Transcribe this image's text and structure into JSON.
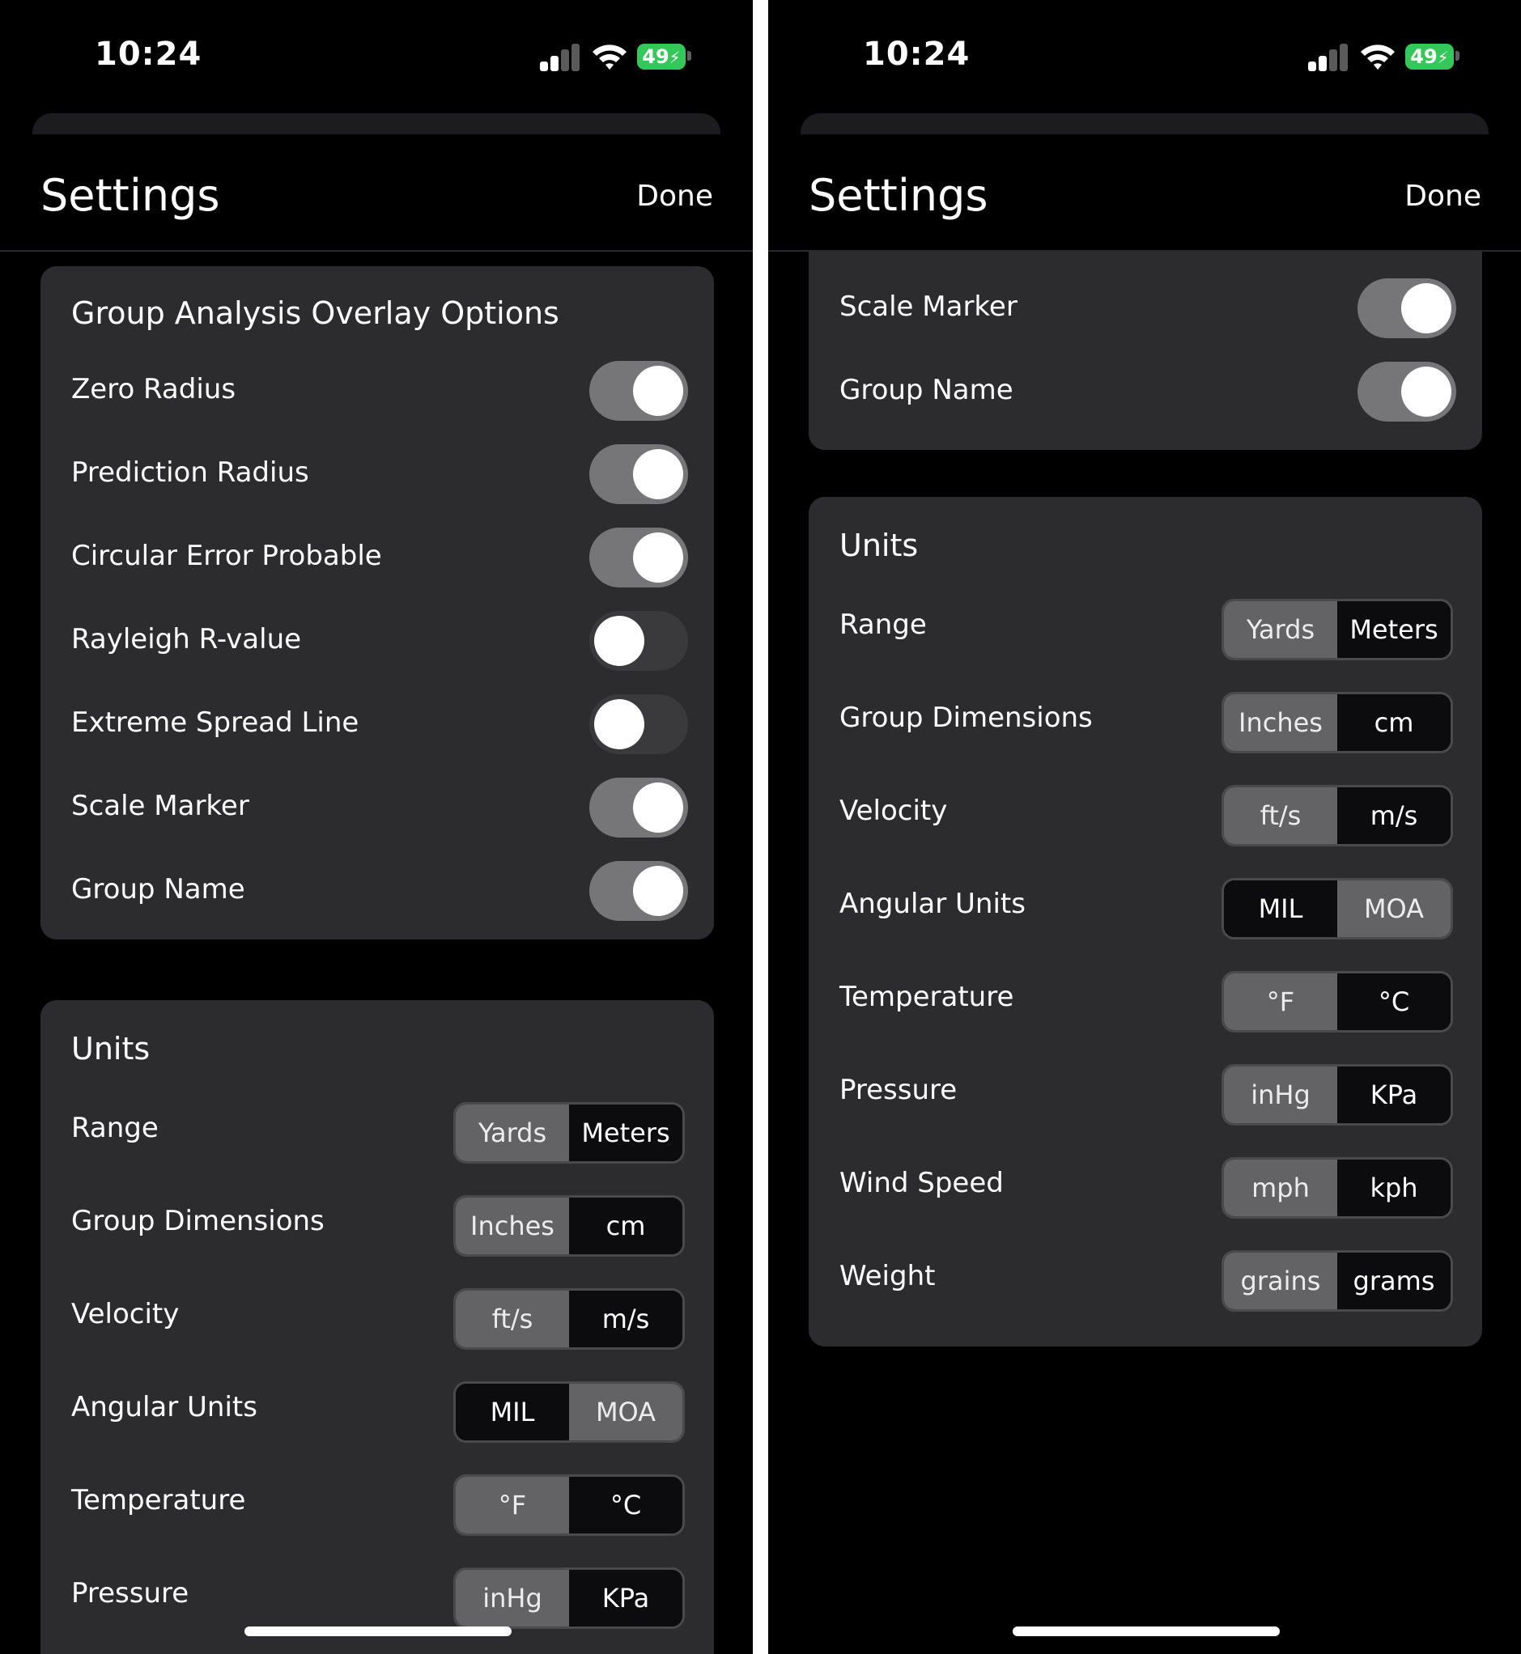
{
  "colors": {
    "background": "#000000",
    "card": "#2c2c2e",
    "toggle_on": "#767577",
    "toggle_off": "#3a3a3c",
    "battery": "#34c759"
  },
  "status_bar": {
    "time": "10:24",
    "battery_level": "49",
    "icons": [
      "cellular-signal-icon",
      "wifi-icon",
      "battery-charging-icon"
    ]
  },
  "nav": {
    "title": "Settings",
    "done_label": "Done"
  },
  "overlay_options": {
    "title": "Group Analysis Overlay Options",
    "items": [
      {
        "label": "Zero Radius",
        "on": true
      },
      {
        "label": "Prediction Radius",
        "on": true
      },
      {
        "label": "Circular Error Probable",
        "on": true
      },
      {
        "label": "Rayleigh R-value",
        "on": false
      },
      {
        "label": "Extreme Spread Line",
        "on": false
      },
      {
        "label": "Scale Marker",
        "on": true
      },
      {
        "label": "Group Name",
        "on": true
      }
    ]
  },
  "units": {
    "title": "Units",
    "items": [
      {
        "label": "Range",
        "options": [
          "Yards",
          "Meters"
        ],
        "selected": "Meters"
      },
      {
        "label": "Group Dimensions",
        "options": [
          "Inches",
          "cm"
        ],
        "selected": "cm"
      },
      {
        "label": "Velocity",
        "options": [
          "ft/s",
          "m/s"
        ],
        "selected": "m/s"
      },
      {
        "label": "Angular Units",
        "options": [
          "MIL",
          "MOA"
        ],
        "selected": "MIL"
      },
      {
        "label": "Temperature",
        "options": [
          "°F",
          "°C"
        ],
        "selected": "°C"
      },
      {
        "label": "Pressure",
        "options": [
          "inHg",
          "KPa"
        ],
        "selected": "KPa"
      },
      {
        "label": "Wind Speed",
        "options": [
          "mph",
          "kph"
        ],
        "selected": "kph"
      },
      {
        "label": "Weight",
        "options": [
          "grains",
          "grams"
        ],
        "selected": "grams"
      }
    ]
  }
}
